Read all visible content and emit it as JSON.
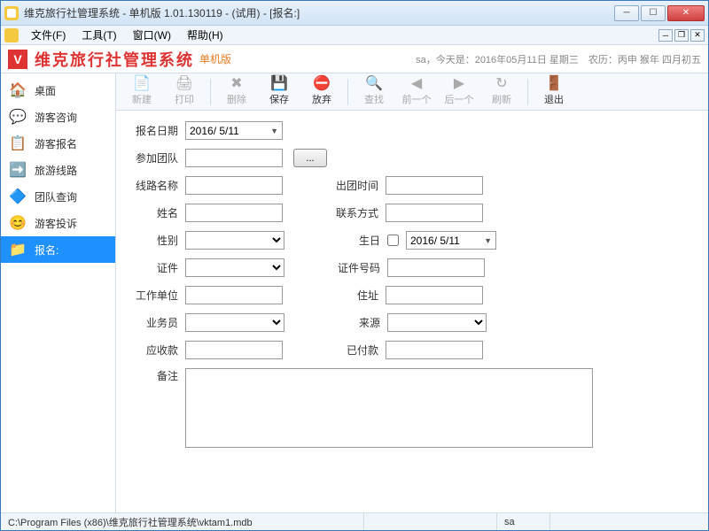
{
  "titlebar": {
    "title": "维克旅行社管理系统 - 单机版 1.01.130119 - (试用) - [报名:]"
  },
  "menu": {
    "file": "文件(F)",
    "tool": "工具(T)",
    "window": "窗口(W)",
    "help": "帮助(H)"
  },
  "banner": {
    "sys_name": "维克旅行社管理系统",
    "edition": "单机版",
    "date_info": "sa，今天是：2016年05月11日 星期三　农历：丙申 猴年 四月初五"
  },
  "sidebar": {
    "items": [
      {
        "label": "桌面",
        "icon": "🏠"
      },
      {
        "label": "游客咨询",
        "icon": "💬"
      },
      {
        "label": "游客报名",
        "icon": "📋"
      },
      {
        "label": "旅游线路",
        "icon": "➡️"
      },
      {
        "label": "团队查询",
        "icon": "🔷"
      },
      {
        "label": "游客投诉",
        "icon": "😊"
      },
      {
        "label": "报名:",
        "icon": "📁"
      }
    ]
  },
  "toolbar": {
    "new": "新建",
    "print": "打印",
    "delete": "删除",
    "save": "保存",
    "discard": "放弃",
    "find": "查找",
    "prev": "前一个",
    "next": "后一个",
    "refresh": "刷新",
    "exit": "退出"
  },
  "form": {
    "labels": {
      "reg_date": "报名日期",
      "team": "参加团队",
      "route": "线路名称",
      "depart": "出团时间",
      "name": "姓名",
      "contact": "联系方式",
      "gender": "性别",
      "birthday": "生日",
      "id_type": "证件",
      "id_no": "证件号码",
      "company": "工作单位",
      "address": "住址",
      "sales": "业务员",
      "source": "来源",
      "receivable": "应收款",
      "paid": "已付款",
      "remark": "备注"
    },
    "values": {
      "reg_date": "2016/ 5/11",
      "birthday": "2016/ 5/11"
    },
    "browse": "..."
  },
  "status": {
    "path": "C:\\Program Files (x86)\\维克旅行社管理系统\\vktam1.mdb",
    "user": "sa"
  }
}
